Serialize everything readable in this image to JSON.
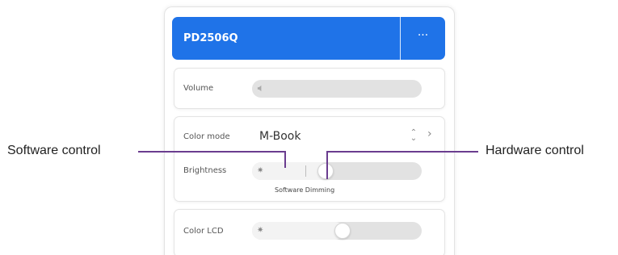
{
  "device": {
    "name": "PD2506Q",
    "more_label": "···",
    "accent_color": "#1f73e8"
  },
  "volume": {
    "label": "Volume",
    "icon": "speaker-icon",
    "level": 0
  },
  "color_mode": {
    "label": "Color mode",
    "value": "M-Book",
    "updown_icon": "updown-arrows-icon",
    "chevron_icon": "chevron-right-icon"
  },
  "brightness": {
    "label": "Brightness",
    "icon": "sun-icon",
    "caption": "Software Dimming"
  },
  "color_lcd": {
    "label": "Color LCD",
    "icon": "sun-icon"
  },
  "annotations": {
    "software": "Software control",
    "hardware": "Hardware control",
    "line_color": "#6a3d8f"
  }
}
